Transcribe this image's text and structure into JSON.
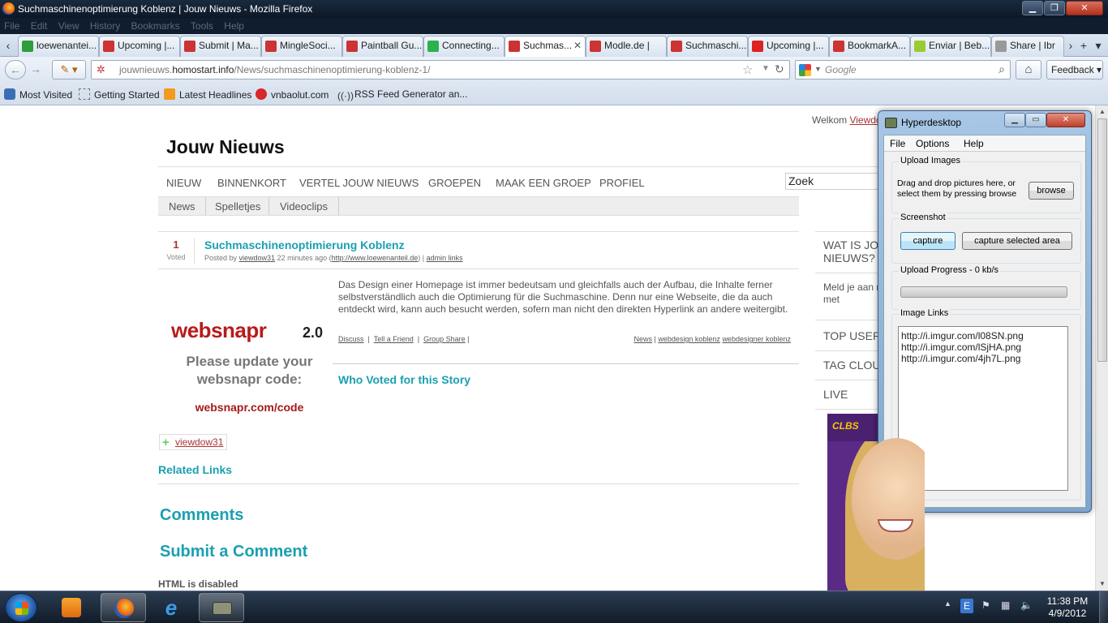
{
  "browser": {
    "window_title": "Suchmaschinenoptimierung Koblenz | Jouw Nieuws - Mozilla Firefox",
    "menu": [
      "File",
      "Edit",
      "View",
      "History",
      "Bookmarks",
      "Tools",
      "Help"
    ],
    "tabs": [
      {
        "label": "loewenantei...",
        "icon_color": "#2e9e3a"
      },
      {
        "label": "Upcoming |...",
        "icon_color": "#c33"
      },
      {
        "label": "Submit | Ma...",
        "icon_color": "#c33"
      },
      {
        "label": "MingleSoci...",
        "icon_color": "#c33"
      },
      {
        "label": "Paintball Gu...",
        "icon_color": "#c33"
      },
      {
        "label": "Connecting...",
        "icon_color": "#2bb24c"
      },
      {
        "label": "Suchmas...",
        "icon_color": "#c33",
        "active": true
      },
      {
        "label": "Modle.de |",
        "icon_color": "#c33"
      },
      {
        "label": "Suchmaschi...",
        "icon_color": "#c33"
      },
      {
        "label": "Upcoming |...",
        "icon_color": "#d22"
      },
      {
        "label": "BookmarkA...",
        "icon_color": "#c33"
      },
      {
        "label": "Enviar | Beb...",
        "icon_color": "#9c3"
      },
      {
        "label": "Share | Ibr",
        "icon_color": "#999"
      }
    ],
    "url_prefix": "jouwnieuws.",
    "url_domain": "homostart.info",
    "url_path": "/News/suchmaschinenoptimierung-koblenz-1/",
    "search_placeholder": "Google",
    "feedback_label": "Feedback",
    "bookmarks": [
      {
        "label": "Most Visited",
        "icon": "most-visited-icon"
      },
      {
        "label": "Getting Started",
        "icon": "getting-started-icon"
      },
      {
        "label": "Latest Headlines",
        "icon": "rss-icon"
      },
      {
        "label": "vnbaolut.com",
        "icon": "vnbaolut-icon"
      },
      {
        "label": "RSS Feed Generator an...",
        "icon": "rss-generator-icon"
      }
    ]
  },
  "page": {
    "welcome_prefix": "Welkom",
    "welcome_user": "Viewdo",
    "site_title": "Jouw Nieuws",
    "main_nav": [
      "NIEUW",
      "BINNENKORT",
      "VERTEL JOUW NIEUWS",
      "GROEPEN",
      "MAAK EEN GROEP",
      "PROFIEL"
    ],
    "search_value": "Zoek",
    "sub_nav": [
      "News",
      "Spelletjes",
      "Videoclips"
    ],
    "story": {
      "votes": "1",
      "votes_label": "Voted",
      "title": "Suchmaschinenoptimierung Koblenz",
      "meta_posted_by": "Posted by",
      "meta_user": "viewdow31",
      "meta_time": "22 minutes ago (",
      "meta_link": "http://www.loewenanteil.de",
      "meta_close": ") |",
      "meta_admin": "admin links",
      "body": "Das Design einer Homepage ist immer bedeutsam und gleichfalls auch der Aufbau, die Inhalte ferner selbstverständlich auch die Optimierung für die Suchmaschine. Denn nur eine Webseite, die da auch entdeckt wird, kann auch besucht werden, sofern man nicht den direkten Hyperlink an andere weitergibt.",
      "actions": [
        "Discuss",
        "Tell a Friend",
        "Group Share"
      ],
      "category": "News",
      "tags": [
        "webdesign koblenz",
        "webdesigner koblenz"
      ]
    },
    "thumbnail": {
      "logo": "websnapr",
      "version": "2.0",
      "message": "Please update your websnapr code:",
      "link": "websnapr.com/code"
    },
    "who_voted_heading": "Who Voted for this Story",
    "voter": "viewdow31",
    "related_links_heading": "Related Links",
    "comments_heading": "Comments",
    "submit_comment_heading": "Submit a Comment",
    "html_disabled": "HTML is disabled",
    "sidebar": {
      "wat_is": "WAT IS JO NIEUWS?",
      "meld_je": "Meld je aan nieuws met",
      "top_users": "TOP USER",
      "tag_cloud": "TAG CLOU",
      "live": "LIVE",
      "ad_logo": "CLBS"
    }
  },
  "hyperdesktop": {
    "title": "Hyperdesktop",
    "menu": [
      "File",
      "Options",
      "Help"
    ],
    "upload_images_label": "Upload Images",
    "upload_desc": "Drag and drop pictures here, or select them by pressing browse",
    "browse_button": "browse",
    "screenshot_label": "Screenshot",
    "capture_button": "capture",
    "capture_selected_button": "capture selected area",
    "progress_label": "Upload Progress - 0 kb/s",
    "progress_value": 0,
    "image_links_label": "Image Links",
    "image_links": [
      "http://i.imgur.com/l08SN.png",
      "http://i.imgur.com/lSjHA.png",
      "http://i.imgur.com/4jh7L.png"
    ]
  },
  "taskbar": {
    "time": "11:38 PM",
    "date": "4/9/2012"
  }
}
